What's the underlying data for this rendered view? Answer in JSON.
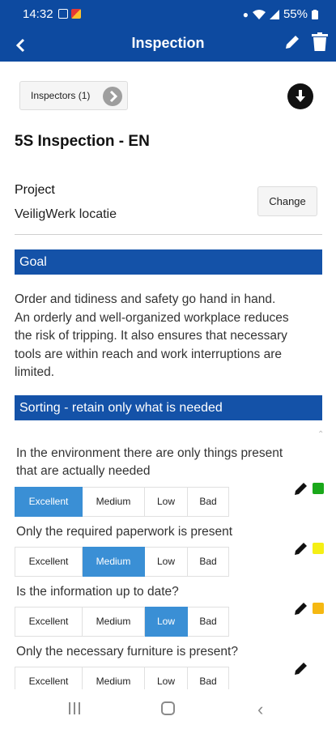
{
  "status": {
    "time": "14:32",
    "battery": "55%"
  },
  "app": {
    "title": "Inspection",
    "back_icon": "arrow-left-icon",
    "edit_icon": "pencil-icon",
    "delete_icon": "trash-icon"
  },
  "inspectors_label": "Inspectors (1)",
  "inspection_title": "5S Inspection - EN",
  "project": {
    "label": "Project",
    "value": "VeiligWerk locatie",
    "change_label": "Change"
  },
  "goal": {
    "heading": "Goal",
    "lines": [
      "Order and tidiness and safety go hand in hand.",
      "An orderly and well-organized workplace reduces",
      "the risk of tripping. It also ensures that necessary",
      "tools are within reach and work interruptions are",
      "limited."
    ]
  },
  "sorting_heading": "Sorting - retain only what is needed",
  "options": [
    "Excellent",
    "Medium",
    "Low",
    "Bad"
  ],
  "questions": [
    {
      "lines": [
        "In the environment there are only things present",
        "that are actually needed"
      ],
      "selected": "Excellent",
      "status_color": "#1aa81a"
    },
    {
      "lines": [
        "Only the required paperwork is present"
      ],
      "selected": "Medium",
      "status_color": "#f5ef15"
    },
    {
      "lines": [
        "Is the information up to date?"
      ],
      "selected": "Low",
      "status_color": "#f5b812"
    },
    {
      "lines": [
        "Only the necessary furniture is present?"
      ],
      "selected": "",
      "status_color": ""
    }
  ],
  "colors": {
    "primary": "#0d4aa0",
    "section": "#1452a8",
    "selected": "#3a8fd5"
  }
}
